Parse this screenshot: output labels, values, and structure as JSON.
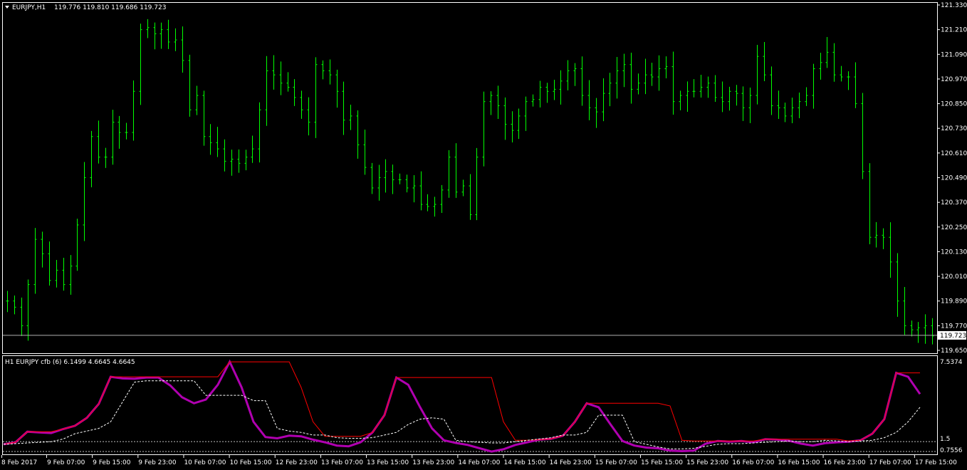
{
  "header": {
    "dropdown_icon": "triangle-down-icon",
    "symbol": "EURJPY,H1",
    "ohlc": "119.776 119.810 119.686 119.723"
  },
  "indicator": {
    "title": "H1 EURJPY cfb (6) 6.1499 4.6645 4.6645",
    "axis_labels": [
      "7.5374",
      "1.5",
      "0.7556"
    ]
  },
  "price_axis": {
    "labels": [
      "121.330",
      "121.210",
      "121.090",
      "120.970",
      "120.850",
      "120.730",
      "120.610",
      "120.490",
      "120.370",
      "120.250",
      "120.130",
      "120.010",
      "119.890",
      "119.770",
      "119.650"
    ],
    "current_price": "119.723"
  },
  "time_axis": {
    "labels": [
      "8 Feb 2017",
      "9 Feb 07:00",
      "9 Feb 15:00",
      "9 Feb 23:00",
      "10 Feb 07:00",
      "10 Feb 15:00",
      "12 Feb 23:00",
      "13 Feb 07:00",
      "13 Feb 15:00",
      "13 Feb 23:00",
      "14 Feb 07:00",
      "14 Feb 15:00",
      "14 Feb 23:00",
      "15 Feb 07:00",
      "15 Feb 15:00",
      "15 Feb 23:00",
      "16 Feb 07:00",
      "16 Feb 15:00",
      "16 Feb 23:00",
      "17 Feb 07:00",
      "17 Feb 15:00"
    ]
  },
  "colors": {
    "background": "#000000",
    "bars": "#00ff00",
    "axis": "#ffffff",
    "indicator_main": "#b000b0",
    "indicator_upper": "#ff0000",
    "indicator_lower": "#ffffff",
    "level_lines": "#c0c0c0"
  },
  "chart_data": [
    {
      "type": "ohlc",
      "symbol": "EURJPY",
      "timeframe": "H1",
      "ylim": [
        119.65,
        121.33
      ],
      "closes": [
        119.89,
        119.86,
        119.77,
        119.97,
        120.19,
        120.12,
        119.99,
        120.04,
        119.97,
        120.06,
        120.26,
        120.49,
        120.69,
        120.59,
        120.59,
        120.76,
        120.71,
        120.71,
        120.91,
        121.21,
        121.22,
        121.19,
        121.21,
        121.15,
        121.16,
        121.06,
        120.82,
        120.89,
        120.69,
        120.66,
        120.63,
        120.57,
        120.58,
        120.56,
        120.59,
        120.63,
        120.82,
        121.01,
        120.99,
        120.95,
        120.93,
        120.88,
        120.82,
        120.76,
        121.04,
        121.01,
        120.99,
        120.91,
        120.77,
        120.79,
        120.65,
        120.54,
        120.44,
        120.49,
        120.52,
        120.48,
        120.48,
        120.44,
        120.45,
        120.36,
        120.35,
        120.36,
        120.43,
        120.59,
        120.42,
        120.45,
        120.31,
        120.59,
        120.86,
        120.89,
        120.84,
        120.75,
        120.72,
        120.79,
        120.86,
        120.87,
        120.93,
        120.91,
        120.92,
        120.96,
        121.01,
        121.02,
        120.89,
        120.83,
        120.81,
        120.9,
        120.95,
        121.01,
        121.04,
        120.92,
        120.95,
        120.99,
        120.98,
        121.02,
        121.03,
        120.86,
        120.89,
        120.91,
        120.91,
        120.93,
        120.95,
        120.88,
        120.86,
        120.91,
        120.9,
        120.83,
        120.89,
        121.08,
        120.99,
        120.84,
        120.83,
        120.79,
        120.83,
        120.86,
        120.89,
        121.02,
        121.05,
        121.1,
        120.99,
        120.98,
        120.98,
        120.85,
        120.52,
        120.2,
        120.21,
        120.2,
        120.08,
        119.89,
        119.77,
        119.75,
        119.76,
        119.77,
        119.72
      ]
    },
    {
      "type": "line",
      "name": "cfb (6)",
      "ylim": [
        0.7556,
        7.5374
      ],
      "levels": [
        1.5,
        0.7556
      ],
      "series": [
        {
          "role": "main",
          "color": "#b000b0",
          "values": [
            1.3,
            1.45,
            2.25,
            2.2,
            2.15,
            2.45,
            2.7,
            3.3,
            4.35,
            6.4,
            6.28,
            6.25,
            6.35,
            6.35,
            5.75,
            4.85,
            4.4,
            4.68,
            5.8,
            7.53,
            5.6,
            3.0,
            1.85,
            1.75,
            1.95,
            1.9,
            1.65,
            1.45,
            1.2,
            1.15,
            1.45,
            2.2,
            3.5,
            6.35,
            5.8,
            4.1,
            2.5,
            1.6,
            1.4,
            1.25,
            1.0,
            0.75,
            0.92,
            1.25,
            1.45,
            1.65,
            1.72,
            1.95,
            3.0,
            4.4,
            4.1,
            2.8,
            1.55,
            1.2,
            1.05,
            1.0,
            0.82,
            0.78,
            0.82,
            1.35,
            1.55,
            1.5,
            1.55,
            1.45,
            1.68,
            1.65,
            1.56,
            1.35,
            1.2,
            1.38,
            1.45,
            1.5,
            1.6,
            2.1,
            3.2,
            6.7,
            6.4,
            5.1
          ]
        },
        {
          "role": "upper",
          "color": "#ff0000",
          "values": [
            1.3,
            1.45,
            2.25,
            2.25,
            2.25,
            2.45,
            2.7,
            3.3,
            4.35,
            6.4,
            6.4,
            6.4,
            6.4,
            6.4,
            6.4,
            6.4,
            6.4,
            6.4,
            6.4,
            7.53,
            7.53,
            7.53,
            7.53,
            7.53,
            7.53,
            5.6,
            3.0,
            1.9,
            1.9,
            1.9,
            1.9,
            2.2,
            3.5,
            6.35,
            6.35,
            6.35,
            6.35,
            6.35,
            6.35,
            6.35,
            6.35,
            6.35,
            3.0,
            1.6,
            1.6,
            1.65,
            1.72,
            1.95,
            3.0,
            4.4,
            4.4,
            4.4,
            4.4,
            4.4,
            4.4,
            4.4,
            4.2,
            1.6,
            1.55,
            1.55,
            1.55,
            1.55,
            1.55,
            1.55,
            1.68,
            1.68,
            1.68,
            1.68,
            1.68,
            1.68,
            1.68,
            1.55,
            1.6,
            2.1,
            3.2,
            6.7,
            6.7,
            6.7
          ]
        },
        {
          "role": "lower",
          "color": "#ffffff",
          "values": [
            1.3,
            1.35,
            1.4,
            1.45,
            1.5,
            1.7,
            2.1,
            2.3,
            2.5,
            3.0,
            4.5,
            6.0,
            6.1,
            6.1,
            6.1,
            6.1,
            6.1,
            5.0,
            5.0,
            5.0,
            5.0,
            4.6,
            4.6,
            2.5,
            2.3,
            2.2,
            2.0,
            2.0,
            1.8,
            1.75,
            1.75,
            1.8,
            2.0,
            2.2,
            2.8,
            3.2,
            3.3,
            3.2,
            1.6,
            1.5,
            1.45,
            1.4,
            1.4,
            1.5,
            1.6,
            1.7,
            1.8,
            2.0,
            2.0,
            2.2,
            3.5,
            3.5,
            3.5,
            1.5,
            1.3,
            1.1,
            0.95,
            0.95,
            1.0,
            1.15,
            1.3,
            1.35,
            1.35,
            1.4,
            1.45,
            1.5,
            1.55,
            1.5,
            1.5,
            1.6,
            1.55,
            1.5,
            1.55,
            1.6,
            1.8,
            2.2,
            3.0,
            4.1
          ]
        }
      ]
    }
  ]
}
